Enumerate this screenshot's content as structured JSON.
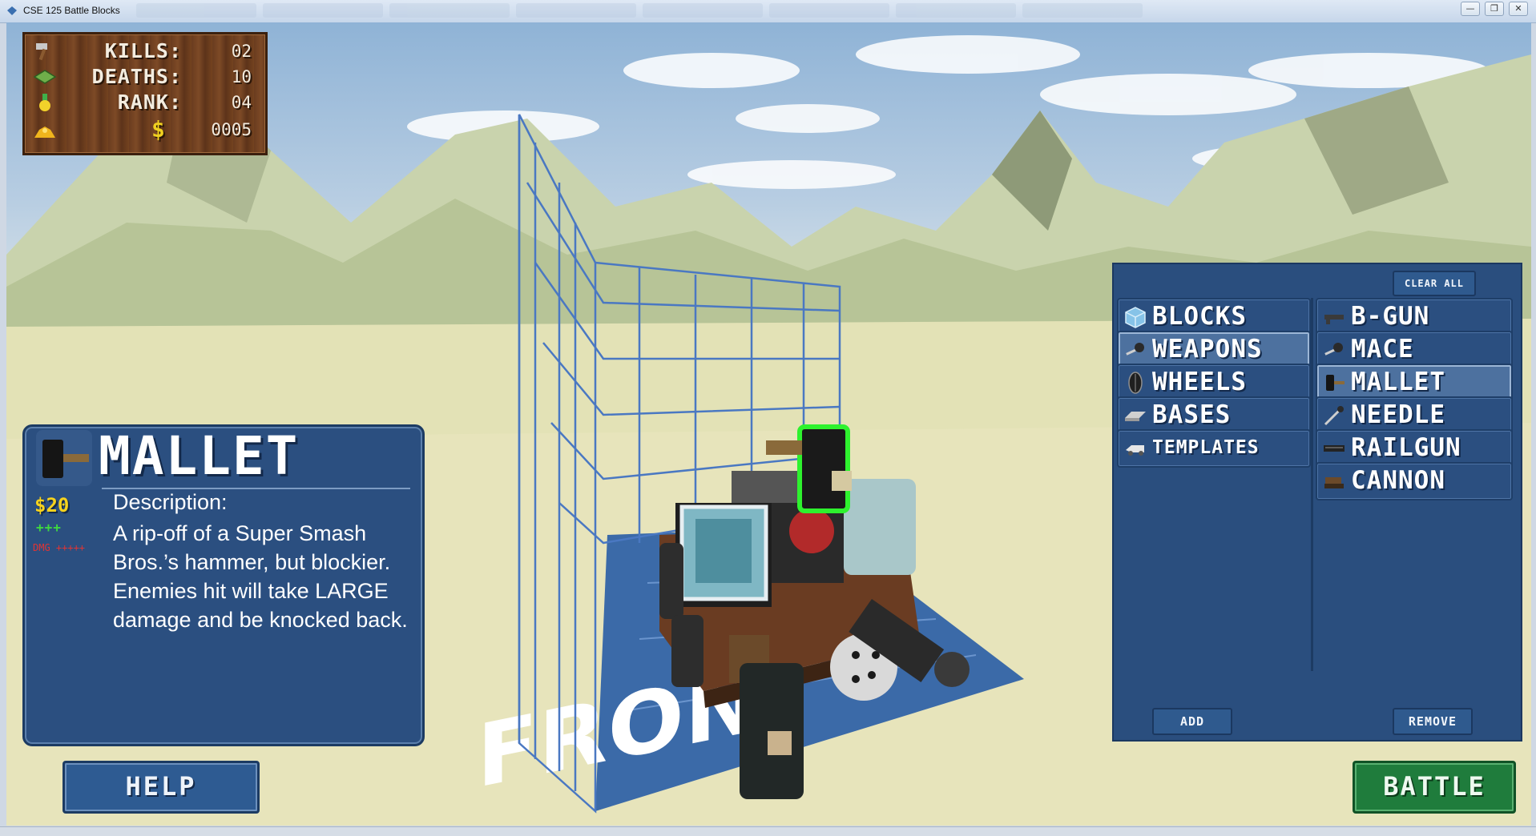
{
  "window": {
    "title": "CSE 125 Battle Blocks",
    "controls": {
      "minimize": "—",
      "restore": "❐",
      "close": "✕"
    }
  },
  "hud": {
    "kills_label": "KILLS:",
    "kills_value": "02",
    "deaths_label": "DEATHS:",
    "deaths_value": "10",
    "rank_label": "RANK:",
    "rank_value": "04",
    "money_symbol": "$",
    "money_value": "0005",
    "icons": [
      "hammer-icon",
      "grid-icon",
      "medal-icon",
      "gold-pile-icon"
    ]
  },
  "selected_item": {
    "name": "MALLET",
    "price": "$20",
    "rating": "+++",
    "damage_label": "DMG +++++",
    "description_heading": "Description:",
    "description": "A rip-off of a Super Smash Bros.’s hammer, but blockier.  Enemies hit will take LARGE damage and be knocked back."
  },
  "buttons": {
    "help": "HELP",
    "battle": "BATTLE"
  },
  "inventory": {
    "clear_all": "CLEAR ALL",
    "add": "ADD",
    "remove": "REMOVE",
    "categories": [
      {
        "label": "BLOCKS",
        "icon": "cube-icon",
        "selected": false
      },
      {
        "label": "WEAPONS",
        "icon": "mace-icon",
        "selected": true
      },
      {
        "label": "WHEELS",
        "icon": "wheel-icon",
        "selected": false
      },
      {
        "label": "BASES",
        "icon": "base-plate-icon",
        "selected": false
      },
      {
        "label": "TEMPLATES",
        "icon": "template-icon",
        "selected": false
      }
    ],
    "weapons": [
      {
        "label": "B-GUN",
        "icon": "gun-icon",
        "selected": false
      },
      {
        "label": "MACE",
        "icon": "mace-icon",
        "selected": false
      },
      {
        "label": "MALLET",
        "icon": "mallet-icon",
        "selected": true
      },
      {
        "label": "NEEDLE",
        "icon": "needle-icon",
        "selected": false
      },
      {
        "label": "RAILGUN",
        "icon": "railgun-icon",
        "selected": false
      },
      {
        "label": "CANNON",
        "icon": "cannon-icon",
        "selected": false
      }
    ]
  },
  "scene": {
    "floor_text": "FRONT"
  },
  "colors": {
    "panel": "#2b4f80",
    "panel_border": "#1c3b63",
    "battle_green": "#1f7c3c",
    "price_yellow": "#f6d21d",
    "plus_green": "#3fd83f",
    "dmg_red": "#e03434",
    "hud_wood": "#6a3c1f"
  }
}
